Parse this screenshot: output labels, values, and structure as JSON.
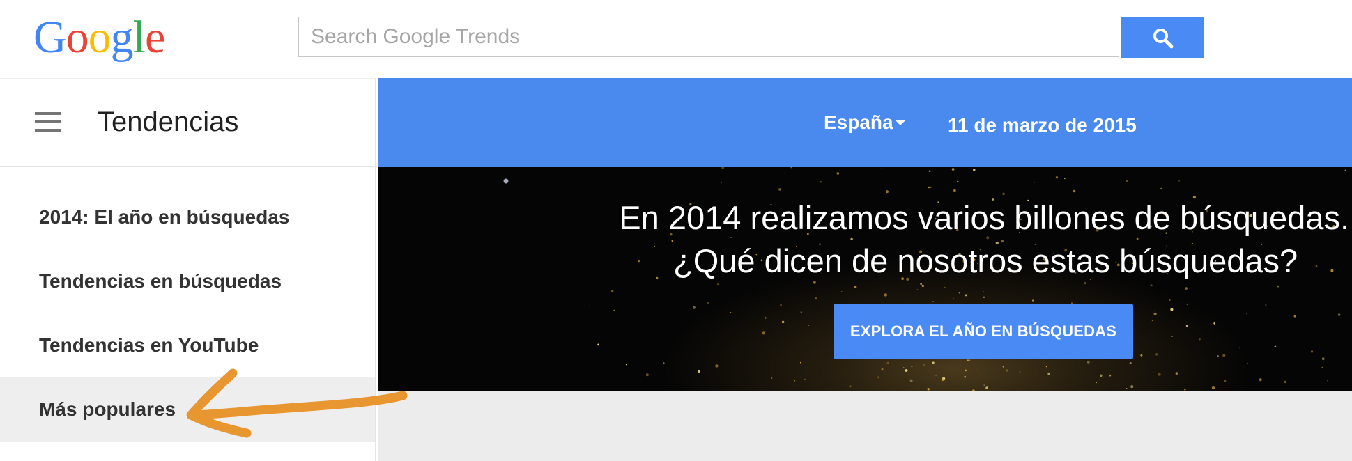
{
  "header": {
    "logo": [
      "G",
      "o",
      "o",
      "g",
      "l",
      "e"
    ],
    "logo_colors": [
      "#4285f4",
      "#ea4335",
      "#fbbc05",
      "#4285f4",
      "#34a853",
      "#ea4335"
    ],
    "search": {
      "placeholder": "Search Google Trends",
      "value": ""
    },
    "search_icon": "magnifier-icon"
  },
  "sidebar": {
    "menu_icon": "hamburger-menu-icon",
    "title": "Tendencias",
    "items": [
      {
        "label": "2014: El año en búsquedas",
        "active": false
      },
      {
        "label": "Tendencias en búsquedas",
        "active": false
      },
      {
        "label": "Tendencias en YouTube",
        "active": false
      },
      {
        "label": "Más populares",
        "active": true
      }
    ]
  },
  "toolbar": {
    "country": "España",
    "date": "11 de marzo de 2015"
  },
  "hero": {
    "line1": "En 2014 realizamos varios billones de búsquedas.",
    "line2": "¿Qué dicen de nosotros estas búsquedas?",
    "button_label": "EXPLORA EL AÑO EN BÚSQUEDAS"
  },
  "annotation": {
    "shape": "hand-drawn arrow",
    "color": "#e8962f"
  },
  "colors": {
    "accent_blue": "#4a89ee",
    "button_blue": "#4a8af4",
    "active_item_bg": "#eeeeee",
    "main_bg": "#ececec"
  }
}
